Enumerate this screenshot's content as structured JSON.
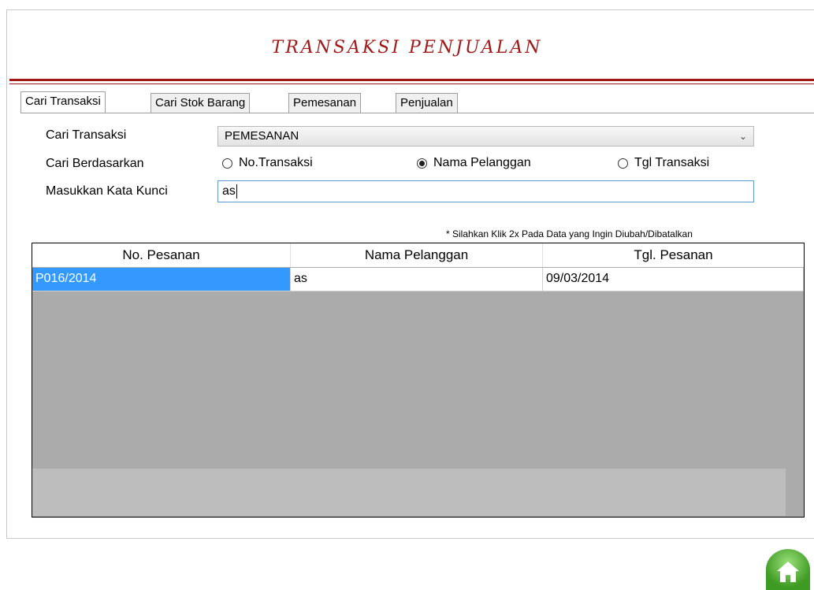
{
  "title": "TRANSAKSI PENJUALAN",
  "tabs": [
    {
      "label": "Cari Transaksi",
      "active": true
    },
    {
      "label": "Cari Stok Barang",
      "active": false
    },
    {
      "label": "Pemesanan",
      "active": false
    },
    {
      "label": "Penjualan",
      "active": false
    }
  ],
  "form": {
    "cari_transaksi_label": "Cari Transaksi",
    "cari_transaksi_value": "PEMESANAN",
    "cari_berdasarkan_label": "Cari Berdasarkan",
    "radio_options": [
      {
        "label": "No.Transaksi",
        "selected": false
      },
      {
        "label": "Nama Pelanggan",
        "selected": true
      },
      {
        "label": "Tgl Transaksi",
        "selected": false
      }
    ],
    "kata_kunci_label": "Masukkan Kata Kunci",
    "kata_kunci_value": "as"
  },
  "note": "* Silahkan Klik 2x Pada Data yang Ingin Diubah/Dibatalkan",
  "table": {
    "columns": [
      "No. Pesanan",
      "Nama Pelanggan",
      "Tgl. Pesanan"
    ],
    "rows": [
      [
        "P016/2014",
        "as",
        "09/03/2014"
      ]
    ]
  },
  "icons": {
    "home": "home-icon"
  },
  "colors": {
    "title": "#a01818",
    "selection": "#3399ff",
    "home_button": "#3d9a22"
  }
}
